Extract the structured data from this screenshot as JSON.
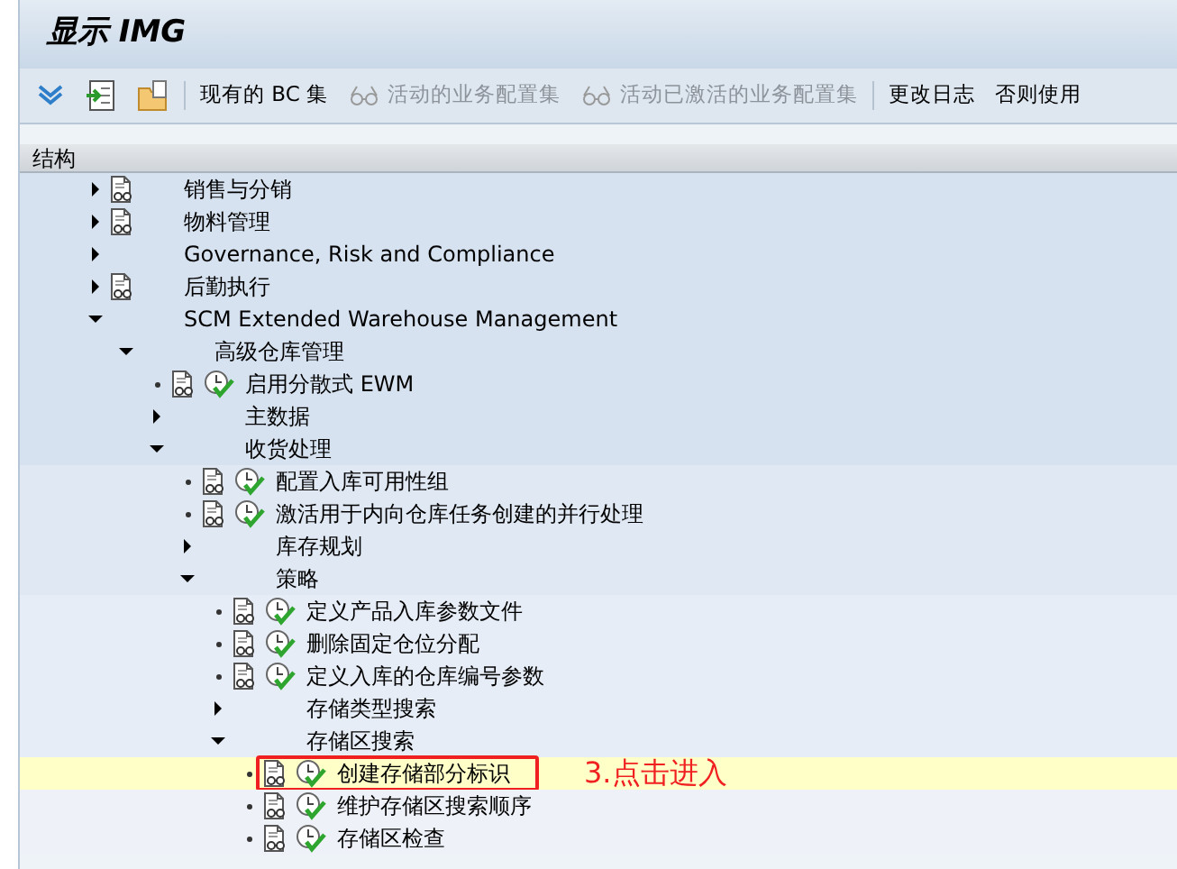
{
  "window": {
    "title": "显示 IMG"
  },
  "toolbar": {
    "buttons": [
      {
        "kind": "text",
        "label": "现有的 BC 集",
        "disabled": false
      },
      {
        "kind": "glasses",
        "label": "活动的业务配置集",
        "disabled": true
      },
      {
        "kind": "glasses",
        "label": "活动已激活的业务配置集",
        "disabled": true
      },
      {
        "kind": "separator"
      },
      {
        "kind": "text",
        "label": "更改日志",
        "disabled": false
      },
      {
        "kind": "text",
        "label": "否则使用",
        "disabled": false
      }
    ]
  },
  "tree": {
    "header": "结构",
    "items": [
      {
        "label": "销售与分销",
        "doc": true,
        "execute": false,
        "expanded": false,
        "selected": false
      },
      {
        "label": "物料管理",
        "doc": true,
        "execute": false,
        "expanded": false,
        "selected": false
      },
      {
        "label": "Governance, Risk and Compliance",
        "doc": false,
        "execute": false,
        "expanded": false,
        "selected": false
      },
      {
        "label": "后勤执行",
        "doc": true,
        "execute": false,
        "expanded": false,
        "selected": false
      },
      {
        "label": "SCM Extended Warehouse Management",
        "doc": false,
        "execute": false,
        "expanded": true,
        "selected": false,
        "children": [
          {
            "label": "高级仓库管理",
            "doc": false,
            "execute": false,
            "expanded": true,
            "selected": false,
            "children": [
              {
                "label": "启用分散式 EWM",
                "doc": true,
                "execute": true,
                "selected": false
              },
              {
                "label": "主数据",
                "doc": false,
                "execute": false,
                "expanded": false,
                "selected": false
              },
              {
                "label": "收货处理",
                "doc": false,
                "execute": false,
                "expanded": true,
                "selected": false,
                "children": [
                  {
                    "label": "配置入库可用性组",
                    "doc": true,
                    "execute": true,
                    "selected": false
                  },
                  {
                    "label": "激活用于内向仓库任务创建的并行处理",
                    "doc": true,
                    "execute": true,
                    "selected": false
                  },
                  {
                    "label": "库存规划",
                    "doc": false,
                    "execute": false,
                    "expanded": false,
                    "selected": false
                  },
                  {
                    "label": "策略",
                    "doc": false,
                    "execute": false,
                    "expanded": true,
                    "selected": false,
                    "children": [
                      {
                        "label": "定义产品入库参数文件",
                        "doc": true,
                        "execute": true,
                        "selected": false
                      },
                      {
                        "label": "删除固定仓位分配",
                        "doc": true,
                        "execute": true,
                        "selected": false
                      },
                      {
                        "label": "定义入库的仓库编号参数",
                        "doc": true,
                        "execute": true,
                        "selected": false
                      },
                      {
                        "label": "存储类型搜索",
                        "doc": false,
                        "execute": false,
                        "expanded": false,
                        "selected": false
                      },
                      {
                        "label": "存储区搜索",
                        "doc": false,
                        "execute": false,
                        "expanded": true,
                        "selected": false,
                        "children": [
                          {
                            "label": "创建存储部分标识",
                            "doc": true,
                            "execute": true,
                            "selected": true,
                            "callout": "3.点击进入"
                          },
                          {
                            "label": "维护存储区搜索顺序",
                            "doc": true,
                            "execute": true,
                            "selected": false
                          },
                          {
                            "label": "存储区检查",
                            "doc": true,
                            "execute": true,
                            "selected": false
                          }
                        ]
                      }
                    ]
                  }
                ]
              }
            ]
          }
        ]
      }
    ]
  }
}
